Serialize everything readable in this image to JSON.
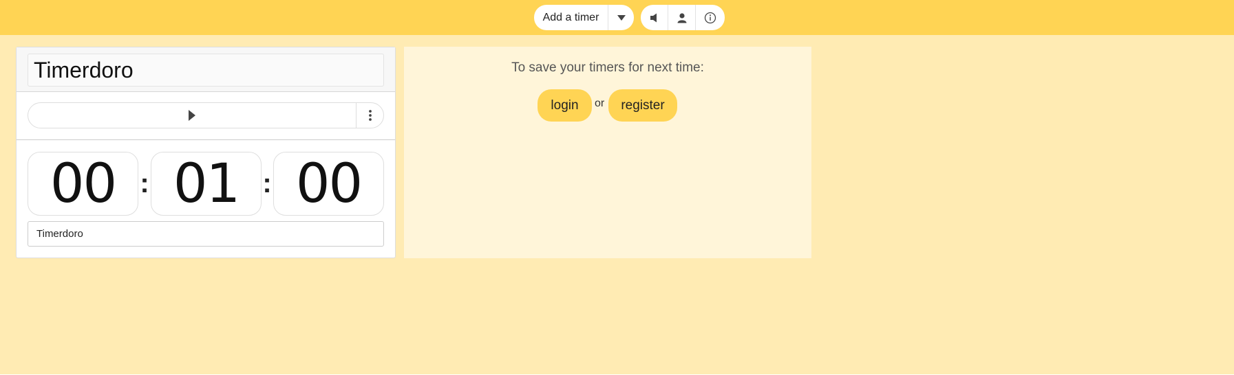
{
  "toolbar": {
    "add_timer_label": "Add a timer",
    "icons": [
      "chevron-down-icon",
      "speaker-icon",
      "user-icon",
      "info-icon"
    ]
  },
  "timer": {
    "title": "Timerdoro",
    "hours": "00",
    "minutes": "01",
    "seconds": "00",
    "separator": ":",
    "name_value": "Timerdoro"
  },
  "save_panel": {
    "message": "To save your timers for next time:",
    "login_label": "login",
    "or_label": "or",
    "register_label": "register"
  },
  "colors": {
    "topbar": "#ffd454",
    "background": "#ffebb3",
    "panel": "#fff5d9",
    "accent_button": "#ffd454"
  }
}
